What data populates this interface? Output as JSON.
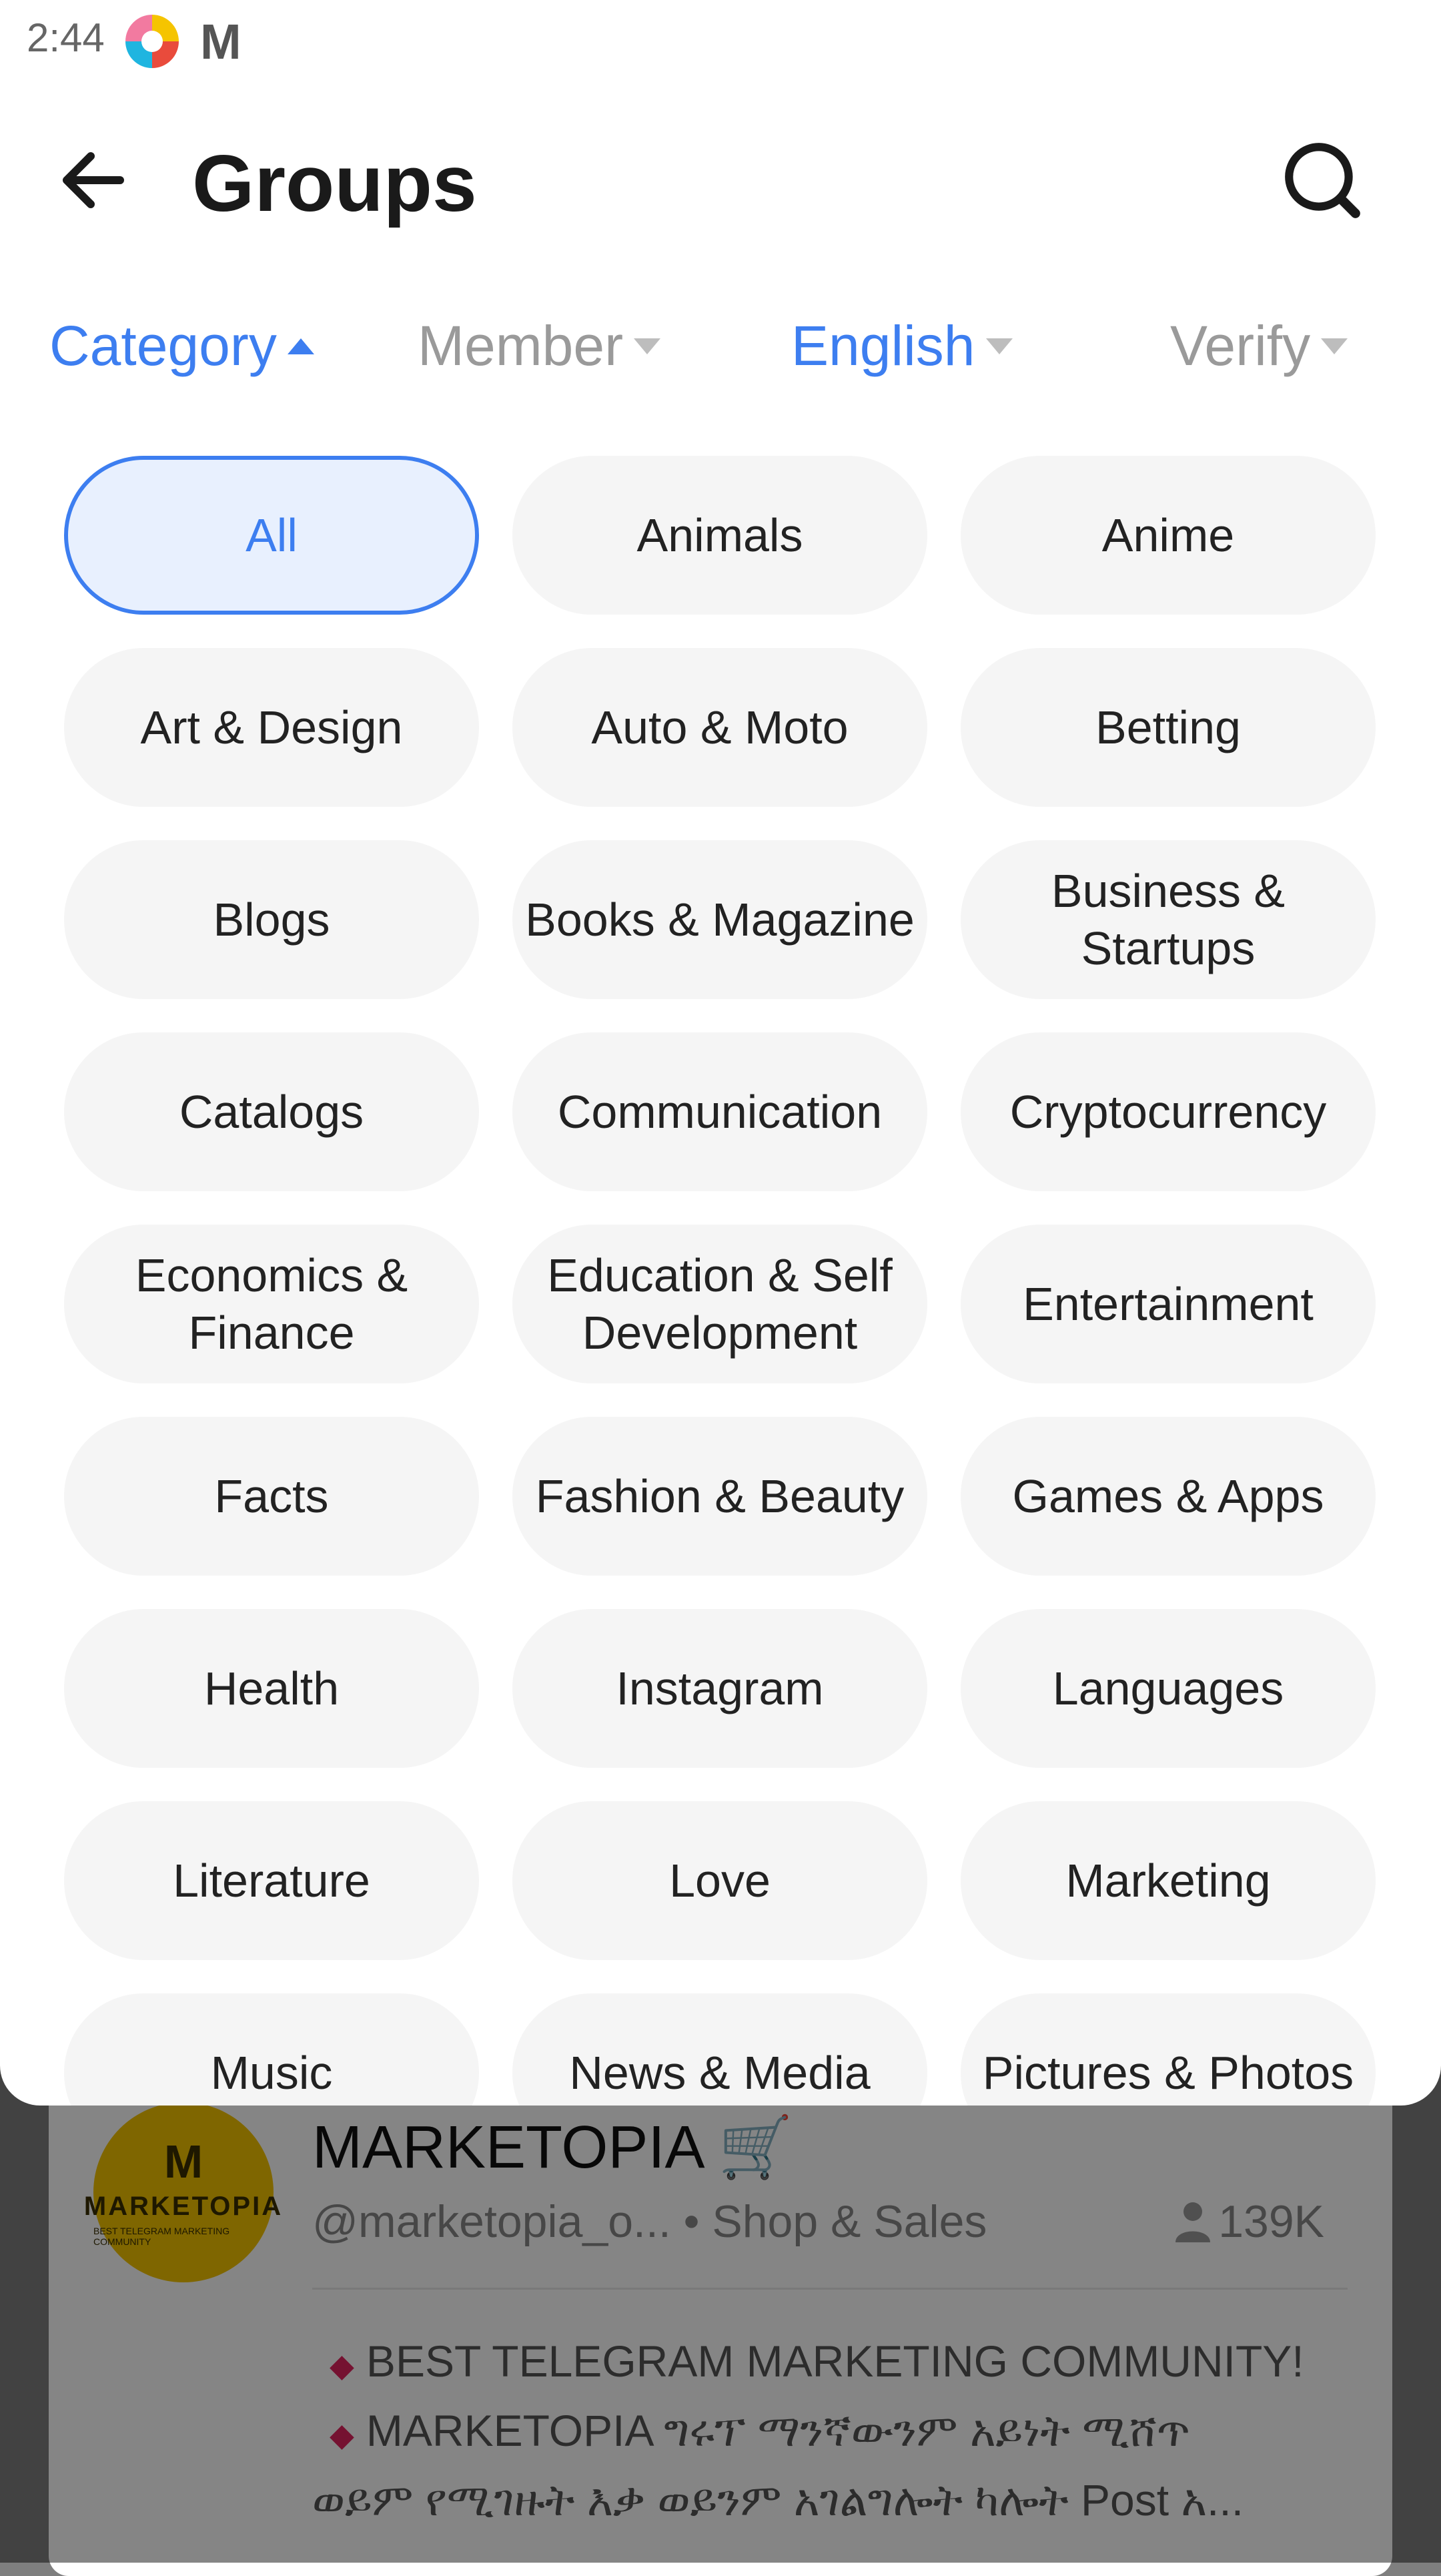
{
  "status_bar": {
    "time": "2:44"
  },
  "header": {
    "title": "Groups"
  },
  "filters": [
    {
      "label": "Category",
      "state": "active",
      "caret": "up"
    },
    {
      "label": "Member",
      "state": "inactive",
      "caret": "down"
    },
    {
      "label": "English",
      "state": "active",
      "caret": "down"
    },
    {
      "label": "Verify",
      "state": "inactive",
      "caret": "down"
    }
  ],
  "categories": [
    "All",
    "Animals",
    "Anime",
    "Art & Design",
    "Auto & Moto",
    "Betting",
    "Blogs",
    "Books & Magazine",
    "Business & Startups",
    "Catalogs",
    "Communication",
    "Cryptocurrency",
    "Economics & Finance",
    "Education & Self Development",
    "Entertainment",
    "Facts",
    "Fashion & Beauty",
    "Games & Apps",
    "Health",
    "Instagram",
    "Languages",
    "Literature",
    "Love",
    "Marketing",
    "Music",
    "News & Media",
    "Pictures & Photos"
  ],
  "selected_category": "All",
  "background_item": {
    "title": "MARKETOPIA 🛒",
    "handle": "@marketopia_o...",
    "category": "Shop & Sales",
    "members": "139K",
    "avatar_text": "MARKETOPIA",
    "avatar_subtext": "BEST TELEGRAM MARKETING COMMUNITY",
    "desc_line1": "BEST TELEGRAM MARKETING COMMUNITY!",
    "desc_line2": "MARKETOPIA ግሩፕ ማንኛውንም አይነት ሚሸጥ",
    "desc_line3": "ወይም የሚገዙት እቃ ወይንም አገልግሎት ካሎት Post አ..."
  },
  "colors": {
    "accent": "#3d7ef0",
    "chip_bg": "#f5f5f5",
    "selected_bg": "#e8f0fe",
    "inactive_text": "#9a9a9a"
  }
}
